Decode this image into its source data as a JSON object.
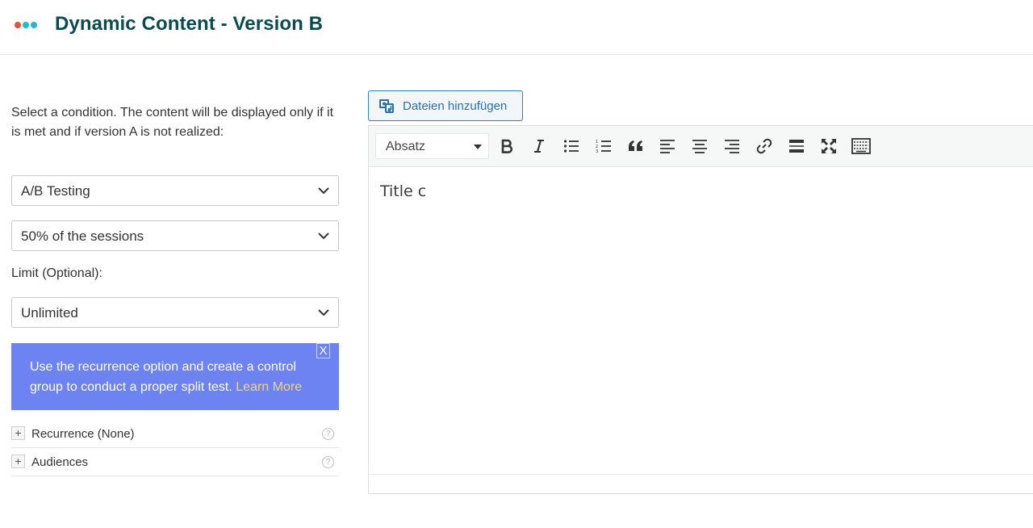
{
  "header": {
    "title": "Dynamic Content - Version B",
    "logo_colors": [
      "#e0533d",
      "#24b9c9",
      "#2ab0d6"
    ]
  },
  "condition": {
    "instructions": "Select a condition. The content will be displayed only if it is met and if version A is not realized:",
    "condition_value": "A/B Testing",
    "sessions_value": "50% of the sessions",
    "limit_label": "Limit (Optional):",
    "limit_value": "Unlimited"
  },
  "banner": {
    "text": "Use the recurrence option and create a control group to conduct a proper split test.",
    "link": "Learn More",
    "close": "X",
    "bg_color": "#6d83f2"
  },
  "accordion": [
    {
      "label": "Recurrence (None)",
      "toggle": "+",
      "help": "?"
    },
    {
      "label": "Audiences",
      "toggle": "+",
      "help": "?"
    }
  ],
  "editor": {
    "add_files_label": "Dateien hinzufügen",
    "format_select": "Absatz",
    "toolbar_icons": [
      "bold-icon",
      "italic-icon",
      "bullet-list-icon",
      "numbered-list-icon",
      "blockquote-icon",
      "align-left-icon",
      "align-center-icon",
      "align-right-icon",
      "link-icon",
      "read-more-icon",
      "fullscreen-icon",
      "toolbar-toggle-icon"
    ],
    "content": "Title c"
  }
}
